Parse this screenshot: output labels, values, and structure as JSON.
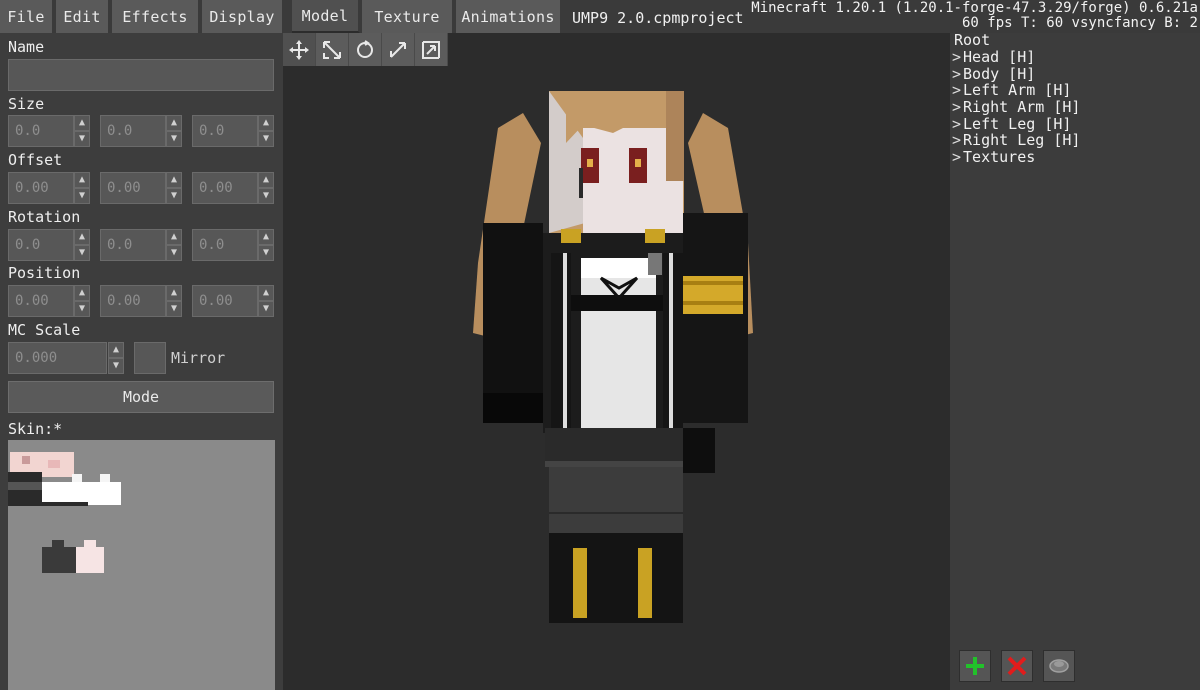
{
  "menu": {
    "file": "File",
    "edit": "Edit",
    "effects": "Effects",
    "display": "Display",
    "model": "Model",
    "texture": "Texture",
    "animations": "Animations"
  },
  "project_title": "UMP9 2.0.cpmproject",
  "mc_info": {
    "line1": "Minecraft 1.20.1 (1.20.1-forge-47.3.29/forge) 0.6.21a",
    "line2": "60 fps T: 60 vsyncfancy B: 2"
  },
  "toolbar": {
    "tools": [
      "move-icon",
      "scale-icon",
      "rotate-icon",
      "resize-icon",
      "size-icon"
    ]
  },
  "properties": {
    "name_label": "Name",
    "name_value": "",
    "size_label": "Size",
    "size_values": [
      "0.0",
      "0.0",
      "0.0"
    ],
    "offset_label": "Offset",
    "offset_values": [
      "0.00",
      "0.00",
      "0.00"
    ],
    "rotation_label": "Rotation",
    "rotation_values": [
      "0.0",
      "0.0",
      "0.0"
    ],
    "position_label": "Position",
    "position_values": [
      "0.00",
      "0.00",
      "0.00"
    ],
    "mc_scale_label": "MC Scale",
    "mc_scale_value": "0.000",
    "mirror_label": "Mirror",
    "mode_label": "Mode",
    "skin_label": "Skin:*"
  },
  "tree": {
    "root": "Root",
    "items": [
      "Head [H]",
      "Body [H]",
      "Left Arm [H]",
      "Right Arm [H]",
      "Left Leg [H]",
      "Right Leg [H]",
      "Textures"
    ]
  },
  "bottom_actions": [
    "add-icon",
    "delete-icon",
    "layer-icon"
  ],
  "colors": {
    "add": "#22c12a",
    "delete": "#e11c1c",
    "hair": "#c39a68",
    "coat": "#1a1a1a",
    "gold": "#e2b72b"
  }
}
